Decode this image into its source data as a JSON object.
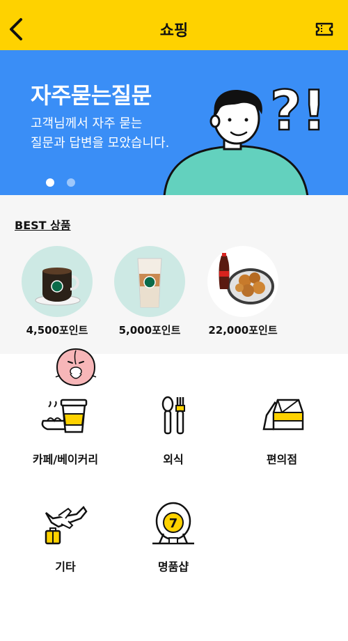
{
  "header": {
    "title": "쇼핑"
  },
  "banner": {
    "title": "자주묻는질문",
    "subtitle_line1": "고객님께서 자주 묻는",
    "subtitle_line2": "질문과 답변을 모았습니다.",
    "art_text": "?!",
    "page_count": 2,
    "active_page": 1
  },
  "best": {
    "title": "BEST 상품",
    "products": [
      {
        "price": "4,500포인트",
        "icon": "hot-coffee-icon"
      },
      {
        "price": "5,000포인트",
        "icon": "iced-latte-icon"
      },
      {
        "price": "22,000포인트",
        "icon": "chicken-cola-icon"
      }
    ]
  },
  "categories": [
    {
      "label": "카페/베이커리",
      "icon": "cafe-bakery-icon"
    },
    {
      "label": "외식",
      "icon": "dining-icon"
    },
    {
      "label": "편의점",
      "icon": "convenience-store-icon"
    },
    {
      "label": "기타",
      "icon": "airplane-icon"
    },
    {
      "label": "명품샵",
      "icon": "luxury-icon"
    }
  ],
  "luxury_badge": "7",
  "colors": {
    "header_bg": "#FED200",
    "banner_bg": "#3A8EF6",
    "accent_yellow": "#FED200",
    "product_circle": "#CDE9E4",
    "section_bg": "#F6F6F6"
  }
}
